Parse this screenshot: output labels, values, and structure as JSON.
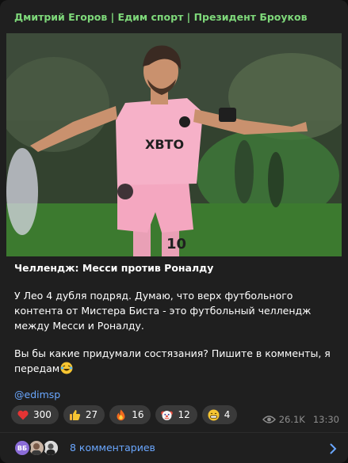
{
  "channel": {
    "title": "Дмитрий Егоров | Едим спорт | Президент Броуков"
  },
  "photo": {
    "jersey_brand": "XBTO",
    "jersey_number": "10"
  },
  "post": {
    "title": "Челлендж: Месси против Роналду",
    "paragraph1": "У Лео 4 дубля подряд. Думаю, что верх футбольного контента от Мистера Биста - это футбольный челлендж между Месси и Роналду.",
    "paragraph2": "Вы бы какие придумали состязания? Пишите в комменты, я передам",
    "handle": "@edimsp"
  },
  "reactions": [
    {
      "icon": "heart-icon",
      "count": "300"
    },
    {
      "icon": "thumbs-up-icon",
      "count": "27"
    },
    {
      "icon": "fire-icon",
      "count": "16"
    },
    {
      "icon": "clown-icon",
      "count": "12"
    },
    {
      "icon": "grin-icon",
      "count": "4"
    }
  ],
  "meta": {
    "views": "26.1K",
    "time": "13:30"
  },
  "comments": {
    "label": "8 комментариев",
    "avatar1_initials": "ВБ"
  },
  "colors": {
    "card_bg": "#1f1f1f",
    "channel_name": "#7ed87a",
    "link": "#6aa7ff",
    "reaction_bg": "#3a3a3a",
    "meta_text": "#8e8e8e"
  }
}
